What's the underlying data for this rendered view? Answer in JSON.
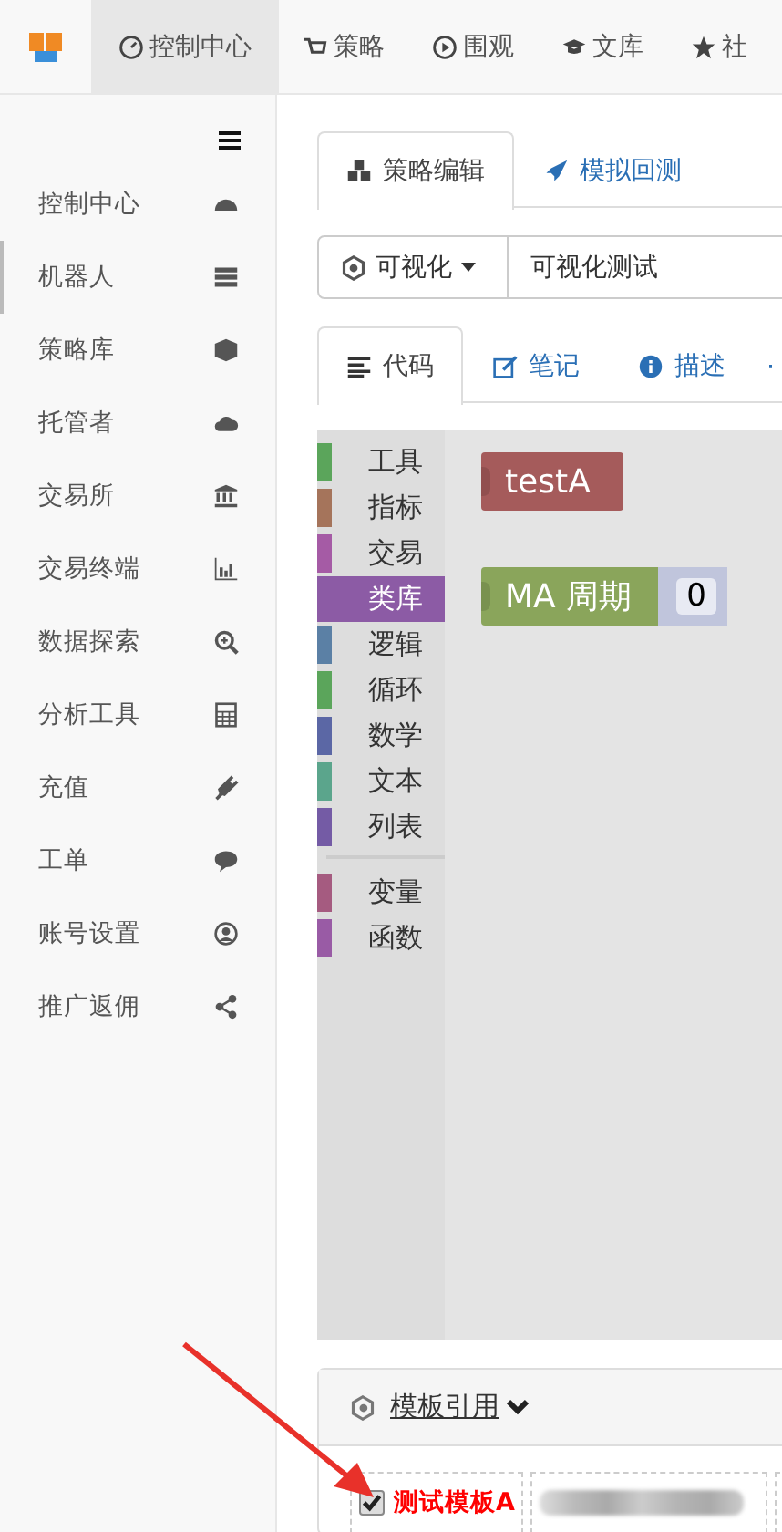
{
  "top_nav": [
    {
      "label": "控制中心",
      "selected": true
    },
    {
      "label": "策略",
      "selected": false
    },
    {
      "label": "围观",
      "selected": false
    },
    {
      "label": "文库",
      "selected": false
    },
    {
      "label": "社",
      "selected": false
    }
  ],
  "sidebar": {
    "items": [
      {
        "label": "控制中心",
        "selected": false
      },
      {
        "label": "机器人",
        "selected": true
      },
      {
        "label": "策略库",
        "selected": false
      },
      {
        "label": "托管者",
        "selected": false
      },
      {
        "label": "交易所",
        "selected": false
      },
      {
        "label": "交易终端",
        "selected": false
      },
      {
        "label": "数据探索",
        "selected": false
      },
      {
        "label": "分析工具",
        "selected": false
      },
      {
        "label": "充值",
        "selected": false
      },
      {
        "label": "工单",
        "selected": false
      },
      {
        "label": "账号设置",
        "selected": false
      },
      {
        "label": "推广返佣",
        "selected": false
      }
    ]
  },
  "editor_tabs": [
    {
      "label": "策略编辑",
      "selected": true
    },
    {
      "label": "模拟回测",
      "selected": false
    }
  ],
  "strategy_type": {
    "label": "可视化"
  },
  "strategy_name": {
    "value": "可视化测试"
  },
  "code_tabs": [
    {
      "label": "代码",
      "selected": true
    },
    {
      "label": "笔记",
      "selected": false
    },
    {
      "label": "描述",
      "selected": false
    }
  ],
  "toolbox": [
    {
      "label": "工具",
      "color": "#5ba55b",
      "selected": false
    },
    {
      "label": "指标",
      "color": "#a5745b",
      "selected": false
    },
    {
      "label": "交易",
      "color": "#a55ba5",
      "selected": false
    },
    {
      "label": "类库",
      "color": "#8c5ba5",
      "selected": true
    },
    {
      "label": "逻辑",
      "color": "#5b80a5",
      "selected": false
    },
    {
      "label": "循环",
      "color": "#5ba55b",
      "selected": false
    },
    {
      "label": "数学",
      "color": "#5b67a5",
      "selected": false
    },
    {
      "label": "文本",
      "color": "#5ba58c",
      "selected": false
    },
    {
      "label": "列表",
      "color": "#745ba5",
      "selected": false
    },
    {
      "label": "变量",
      "color": "#a55b80",
      "selected": false,
      "separator_before": true
    },
    {
      "label": "函数",
      "color": "#995ba5",
      "selected": false
    }
  ],
  "blocks": [
    {
      "kind": "plain",
      "label": "testA",
      "color": "#a55b5b"
    },
    {
      "kind": "with_input",
      "label": "MA 周期",
      "color": "#8aa55b",
      "input": "0"
    }
  ],
  "template_panel": {
    "title": "模板引用",
    "items": [
      {
        "kind": "checkbox",
        "label": "测试模板A",
        "checked": true
      },
      {
        "kind": "blurred"
      },
      {
        "kind": "cut"
      }
    ]
  }
}
